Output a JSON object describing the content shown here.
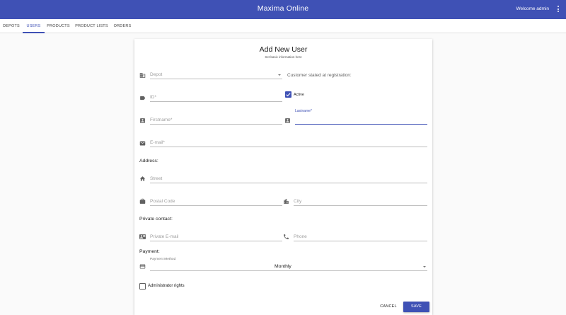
{
  "app": {
    "title": "Maxima Online",
    "welcome": "Welcome admin"
  },
  "tabs": [
    {
      "label": "DEPOTS",
      "active": false
    },
    {
      "label": "USERS",
      "active": true
    },
    {
      "label": "PRODUCTS",
      "active": false
    },
    {
      "label": "PRODUCT LISTS",
      "active": false
    },
    {
      "label": "ORDERS",
      "active": false
    }
  ],
  "form": {
    "title": "Add New User",
    "subtitle": "Set basic information here",
    "depot": {
      "placeholder": "Depot"
    },
    "customer_stated": "Customer stated at registration:",
    "id": {
      "placeholder": "ID",
      "required": "*"
    },
    "active": {
      "label": "Active",
      "checked": true
    },
    "firstname": {
      "placeholder": "Firstname",
      "required": "*"
    },
    "lastname": {
      "label": "Lastname",
      "required": "*",
      "value": ""
    },
    "email": {
      "placeholder": "E-mail",
      "required": "*"
    },
    "address_heading": "Address:",
    "street": {
      "placeholder": "Street"
    },
    "postal_code": {
      "placeholder": "Postal Code"
    },
    "city": {
      "placeholder": "City"
    },
    "private_contact_heading": "Private contact:",
    "private_email": {
      "placeholder": "Private E-mail"
    },
    "phone": {
      "placeholder": "Phone"
    },
    "payment_heading": "Payment:",
    "payment_method": {
      "label": "Payment Method",
      "value": "Monthly"
    },
    "admin_rights": {
      "label": "Administrator rights",
      "checked": false
    },
    "cancel_label": "CANCEL",
    "save_label": "SAVE"
  },
  "colors": {
    "primary": "#3f51b5",
    "background": "#fafafa",
    "icon": "#616161"
  },
  "icons": [
    "business-icon",
    "label-icon",
    "check-icon",
    "account-box-icon",
    "email-icon",
    "home-icon",
    "work-icon",
    "location-city-icon",
    "contact-mail-icon",
    "phone-icon",
    "credit-card-icon",
    "more-vert-icon"
  ]
}
